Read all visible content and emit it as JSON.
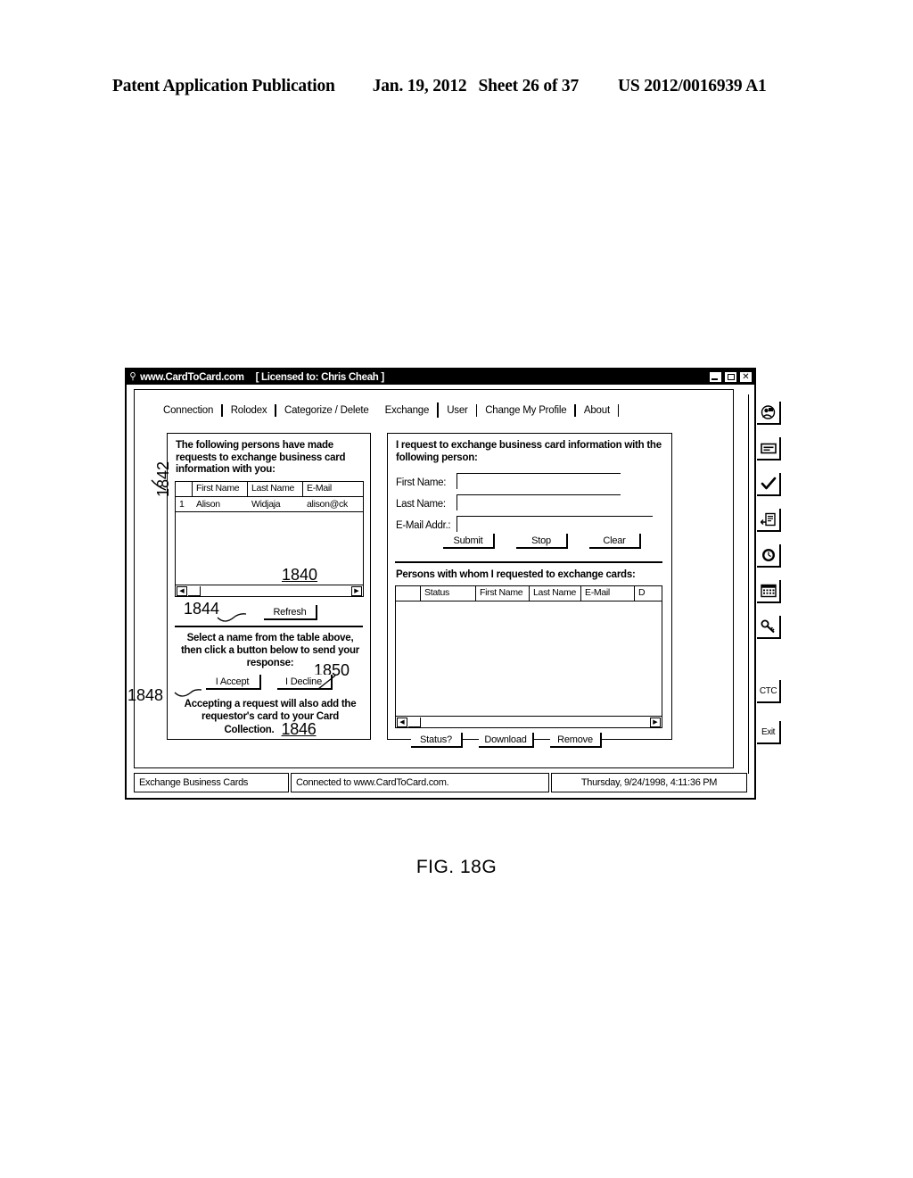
{
  "patent_header": {
    "publication": "Patent Application Publication",
    "date": "Jan. 19, 2012",
    "sheet": "Sheet 26 of 37",
    "number": "US 2012/0016939 A1"
  },
  "figure": {
    "caption": "FIG. 18G"
  },
  "window": {
    "title": "www.CardToCard.com",
    "license": "[ Licensed to: Chris Cheah ]",
    "controls": {
      "minimize": "minimize-button",
      "maximize": "maximize-button",
      "close": "✕"
    }
  },
  "tabs": [
    {
      "label": "Connection",
      "active": false
    },
    {
      "label": "Rolodex",
      "active": false
    },
    {
      "label": "Categorize / Delete",
      "active": false
    },
    {
      "label": "Exchange",
      "active": true
    },
    {
      "label": "User",
      "active": false
    },
    {
      "label": "Change My Profile",
      "active": false
    },
    {
      "label": "About",
      "active": false
    }
  ],
  "left_panel": {
    "ref_panel": "1842",
    "heading": "The following persons have made requests to exchange business card information with you:",
    "table": {
      "ref": "1840",
      "columns": [
        "",
        "First Name",
        "Last Name",
        "E-Mail"
      ],
      "rows": [
        [
          "1",
          "Alison",
          "Widjaja",
          "alison@ck"
        ]
      ]
    },
    "refresh_button": {
      "label": "Refresh",
      "ref": "1844"
    },
    "instruction": "Select a name from the table above, then click a button below to send your response:",
    "accept_button": {
      "label": "I Accept",
      "ref": "1848"
    },
    "decline_button": {
      "label": "I Decline",
      "ref": "1850"
    },
    "note": "Accepting a request will also add the requestor's card to your Card Collection.",
    "note_ref": "1846"
  },
  "right_panel": {
    "heading": "I request to exchange business card information with the following person:",
    "fields": [
      {
        "label": "First Name:",
        "value": "",
        "placeholder": ""
      },
      {
        "label": "Last Name:",
        "value": "",
        "placeholder": ""
      },
      {
        "label": "E-Mail Addr.:",
        "value": "",
        "placeholder": ""
      }
    ],
    "form_buttons": [
      {
        "label": "Submit"
      },
      {
        "label": "Stop"
      },
      {
        "label": "Clear"
      }
    ],
    "subheading": "Persons with whom I requested to exchange cards:",
    "table": {
      "columns": [
        "",
        "Status",
        "First Name",
        "Last Name",
        "E-Mail",
        "D"
      ],
      "rows": []
    },
    "bottom_buttons": [
      {
        "label": "Status?"
      },
      {
        "label": "Download"
      },
      {
        "label": "Remove"
      }
    ]
  },
  "toolbar": [
    {
      "name": "rolodex-icon",
      "label": ""
    },
    {
      "name": "business-card-icon",
      "label": ""
    },
    {
      "name": "checkmark-icon",
      "label": ""
    },
    {
      "name": "document-exchange-icon",
      "label": ""
    },
    {
      "name": "clock-icon",
      "label": ""
    },
    {
      "name": "calendar-icon",
      "label": ""
    },
    {
      "name": "key-icon",
      "label": ""
    },
    {
      "name": "ctc-button",
      "label": "CTC"
    },
    {
      "name": "exit-button",
      "label": "Exit"
    }
  ],
  "statusbar": {
    "mode": "Exchange Business Cards",
    "connection": "Connected to www.CardToCard.com.",
    "datetime": "Thursday, 9/24/1998, 4:11:36 PM"
  }
}
